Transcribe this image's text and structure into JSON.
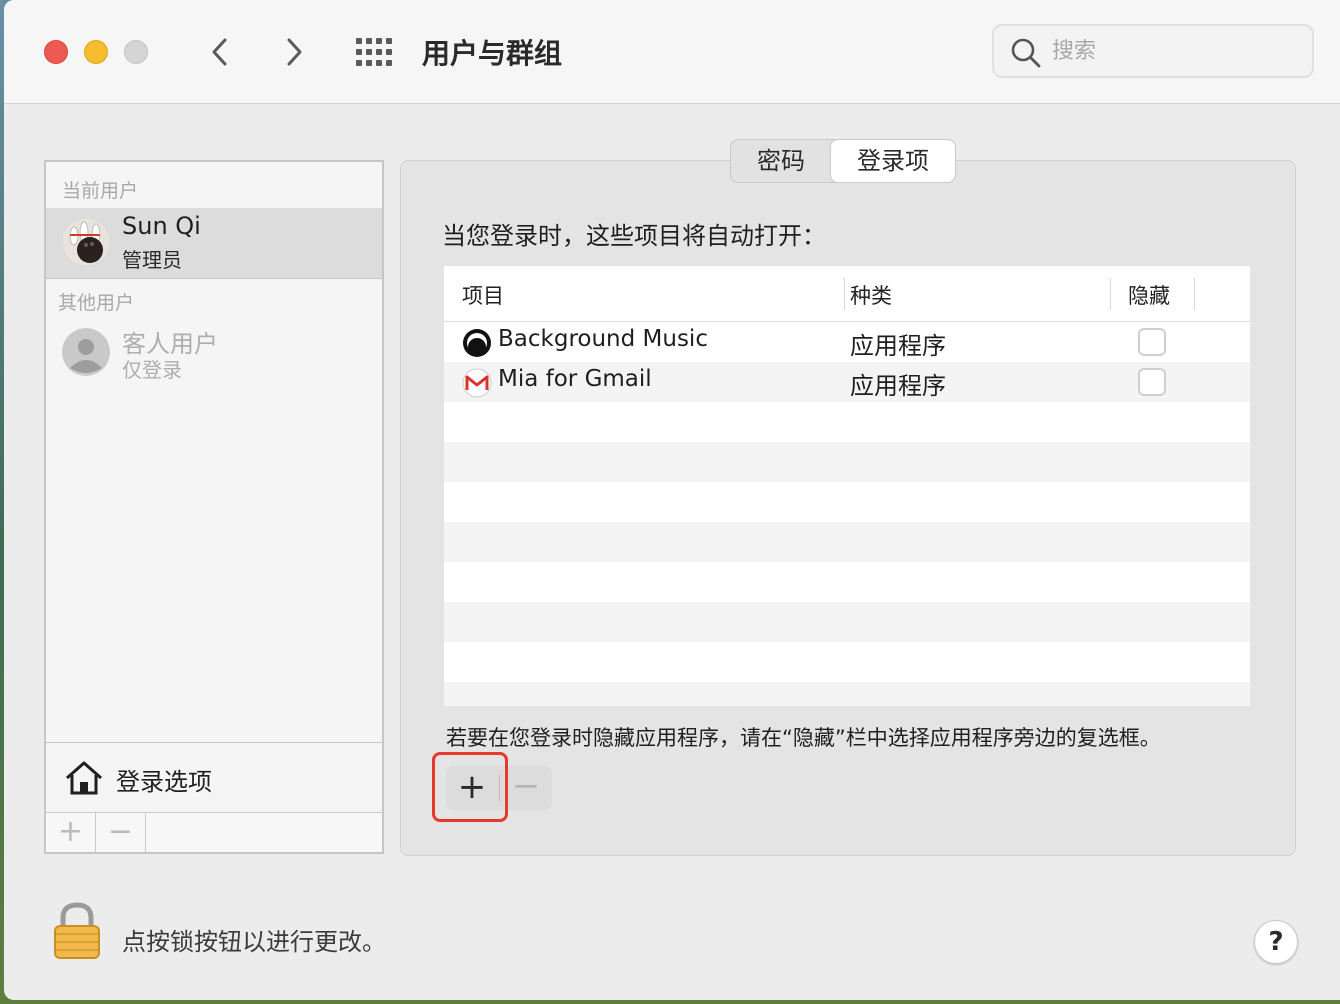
{
  "window": {
    "title": "用户与群组",
    "search_placeholder": "搜索"
  },
  "sidebar": {
    "current_label": "当前用户",
    "current_user": {
      "name": "Sun Qi",
      "role": "管理员"
    },
    "other_label": "其他用户",
    "other_users": [
      {
        "name": "客人用户",
        "role": "仅登录"
      }
    ],
    "login_options_label": "登录选项",
    "add_label": "+",
    "remove_label": "−"
  },
  "tabs": [
    {
      "label": "密码",
      "active": false
    },
    {
      "label": "登录项",
      "active": true
    }
  ],
  "login_items": {
    "intro": "当您登录时，这些项目将自动打开：",
    "columns": {
      "item": "项目",
      "kind": "种类",
      "hide": "隐藏"
    },
    "rows": [
      {
        "name": "Background Music",
        "kind": "应用程序",
        "hidden": false,
        "icon": "background-music-icon"
      },
      {
        "name": "Mia for Gmail",
        "kind": "应用程序",
        "hidden": false,
        "icon": "gmail-icon"
      }
    ],
    "hint": "若要在您登录时隐藏应用程序，请在“隐藏”栏中选择应用程序旁边的复选框。",
    "add_label": "+",
    "remove_label": "−"
  },
  "footer": {
    "lock_text": "点按锁按钮以进行更改。",
    "help_label": "?"
  },
  "colors": {
    "highlight": "#e8372c",
    "close": "#ee5a52",
    "minimize": "#f6bd2e"
  }
}
